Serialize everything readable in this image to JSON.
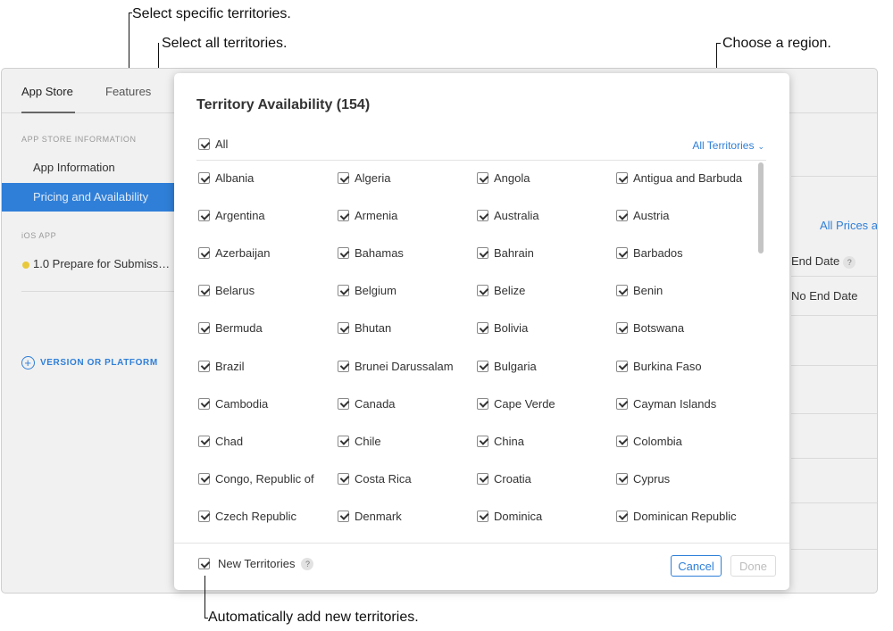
{
  "annotations": {
    "select_specific": "Select specific territories.",
    "select_all": "Select all territories.",
    "choose_region": "Choose a region.",
    "auto_add": "Automatically add new territories."
  },
  "app": {
    "tabs": [
      "App Store",
      "Features"
    ],
    "sidebar": {
      "section_1": "APP STORE INFORMATION",
      "item_app_information": "App Information",
      "item_pricing": "Pricing and Availability",
      "section_2": "iOS APP",
      "item_version": "1.0 Prepare for Submiss…",
      "add_label": "VERSION OR PLATFORM"
    },
    "right": {
      "link": "All Prices ar",
      "end_date_header": "End Date",
      "end_date_value": "No End Date"
    }
  },
  "modal": {
    "title": "Territory Availability (154)",
    "all_label": "All",
    "region_label": "All Territories",
    "territories": [
      "Albania",
      "Algeria",
      "Angola",
      "Antigua and Barbuda",
      "Argentina",
      "Armenia",
      "Australia",
      "Austria",
      "Azerbaijan",
      "Bahamas",
      "Bahrain",
      "Barbados",
      "Belarus",
      "Belgium",
      "Belize",
      "Benin",
      "Bermuda",
      "Bhutan",
      "Bolivia",
      "Botswana",
      "Brazil",
      "Brunei Darussalam",
      "Bulgaria",
      "Burkina Faso",
      "Cambodia",
      "Canada",
      "Cape Verde",
      "Cayman Islands",
      "Chad",
      "Chile",
      "China",
      "Colombia",
      "Congo, Republic of",
      "Costa Rica",
      "Croatia",
      "Cyprus",
      "Czech Republic",
      "Denmark",
      "Dominica",
      "Dominican Republic"
    ],
    "new_territories_label": "New Territories",
    "help_mark": "?",
    "cancel_label": "Cancel",
    "done_label": "Done"
  },
  "colors": {
    "accent": "#2f7fd8",
    "sidebar_active": "#2f7fd8",
    "status_dot": "#e8c93b"
  },
  "icons": {
    "checkbox": "checkmark-icon",
    "chevron": "chevron-down-icon",
    "add": "plus-circle-icon",
    "help": "question-icon"
  }
}
